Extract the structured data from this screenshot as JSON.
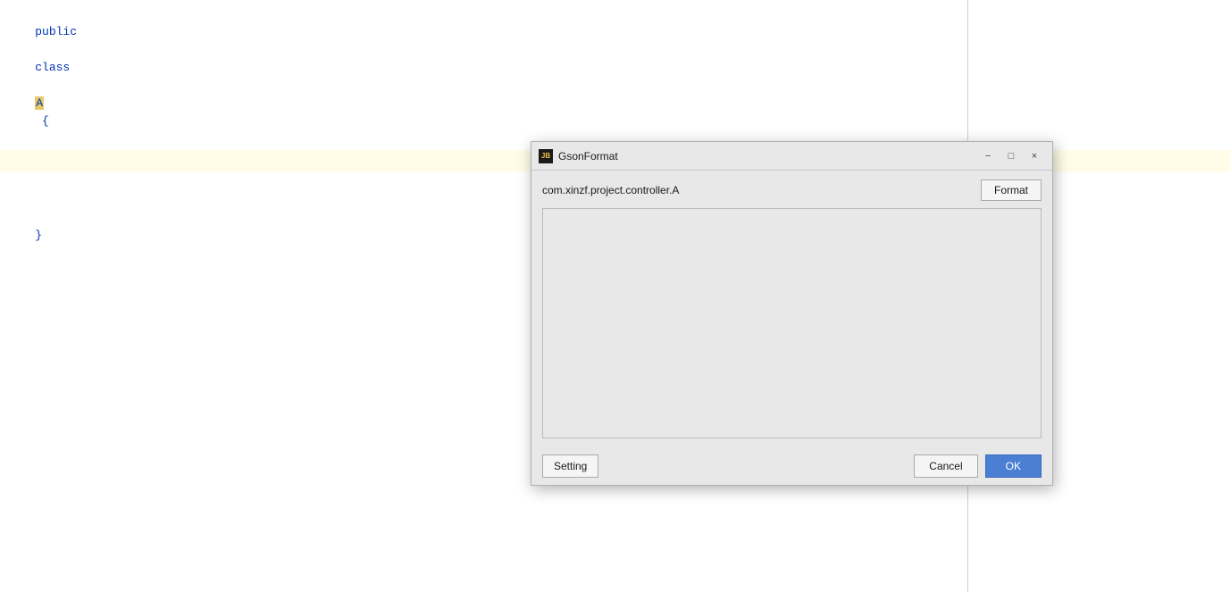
{
  "editor": {
    "lines": [
      {
        "id": "line1",
        "content_raw": "public class A {",
        "highlighted": false
      },
      {
        "id": "line2",
        "content_raw": "",
        "highlighted": true
      },
      {
        "id": "line3",
        "content_raw": "}",
        "highlighted": false
      }
    ],
    "keywords": [
      "public",
      "class"
    ],
    "highlight_word": "A"
  },
  "dialog": {
    "title": "GsonFormat",
    "logo_text": "JB",
    "class_path": "com.xinzf.project.controller.A",
    "format_button_label": "Format",
    "textarea_placeholder": "",
    "setting_button_label": "Setting",
    "cancel_button_label": "Cancel",
    "ok_button_label": "OK",
    "win_minimize": "−",
    "win_maximize": "□",
    "win_close": "×"
  }
}
